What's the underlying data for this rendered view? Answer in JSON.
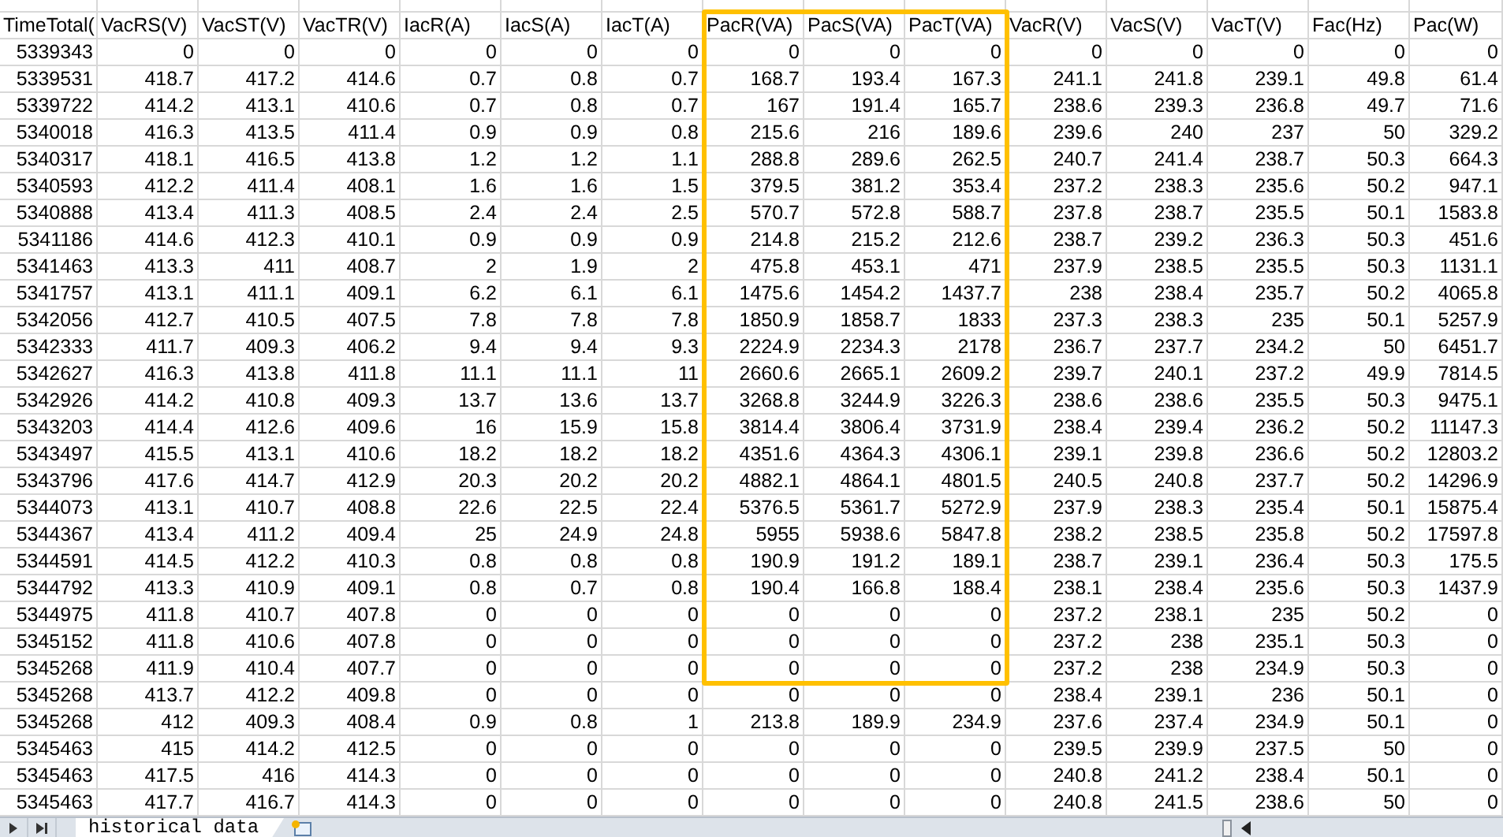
{
  "sheet": {
    "columns": [
      "TimeTotal(",
      "VacRS(V)",
      "VacST(V)",
      "VacTR(V)",
      "IacR(A)",
      "IacS(A)",
      "IacT(A)",
      "PacR(VA)",
      "PacS(VA)",
      "PacT(VA)",
      "VacR(V)",
      "VacS(V)",
      "VacT(V)",
      "Fac(Hz)",
      "Pac(W)"
    ],
    "rows": [
      [
        "5339343",
        "0",
        "0",
        "0",
        "0",
        "0",
        "0",
        "0",
        "0",
        "0",
        "0",
        "0",
        "0",
        "0",
        "0"
      ],
      [
        "5339531",
        "418.7",
        "417.2",
        "414.6",
        "0.7",
        "0.8",
        "0.7",
        "168.7",
        "193.4",
        "167.3",
        "241.1",
        "241.8",
        "239.1",
        "49.8",
        "61.4"
      ],
      [
        "5339722",
        "414.2",
        "413.1",
        "410.6",
        "0.7",
        "0.8",
        "0.7",
        "167",
        "191.4",
        "165.7",
        "238.6",
        "239.3",
        "236.8",
        "49.7",
        "71.6"
      ],
      [
        "5340018",
        "416.3",
        "413.5",
        "411.4",
        "0.9",
        "0.9",
        "0.8",
        "215.6",
        "216",
        "189.6",
        "239.6",
        "240",
        "237",
        "50",
        "329.2"
      ],
      [
        "5340317",
        "418.1",
        "416.5",
        "413.8",
        "1.2",
        "1.2",
        "1.1",
        "288.8",
        "289.6",
        "262.5",
        "240.7",
        "241.4",
        "238.7",
        "50.3",
        "664.3"
      ],
      [
        "5340593",
        "412.2",
        "411.4",
        "408.1",
        "1.6",
        "1.6",
        "1.5",
        "379.5",
        "381.2",
        "353.4",
        "237.2",
        "238.3",
        "235.6",
        "50.2",
        "947.1"
      ],
      [
        "5340888",
        "413.4",
        "411.3",
        "408.5",
        "2.4",
        "2.4",
        "2.5",
        "570.7",
        "572.8",
        "588.7",
        "237.8",
        "238.7",
        "235.5",
        "50.1",
        "1583.8"
      ],
      [
        "5341186",
        "414.6",
        "412.3",
        "410.1",
        "0.9",
        "0.9",
        "0.9",
        "214.8",
        "215.2",
        "212.6",
        "238.7",
        "239.2",
        "236.3",
        "50.3",
        "451.6"
      ],
      [
        "5341463",
        "413.3",
        "411",
        "408.7",
        "2",
        "1.9",
        "2",
        "475.8",
        "453.1",
        "471",
        "237.9",
        "238.5",
        "235.5",
        "50.3",
        "1131.1"
      ],
      [
        "5341757",
        "413.1",
        "411.1",
        "409.1",
        "6.2",
        "6.1",
        "6.1",
        "1475.6",
        "1454.2",
        "1437.7",
        "238",
        "238.4",
        "235.7",
        "50.2",
        "4065.8"
      ],
      [
        "5342056",
        "412.7",
        "410.5",
        "407.5",
        "7.8",
        "7.8",
        "7.8",
        "1850.9",
        "1858.7",
        "1833",
        "237.3",
        "238.3",
        "235",
        "50.1",
        "5257.9"
      ],
      [
        "5342333",
        "411.7",
        "409.3",
        "406.2",
        "9.4",
        "9.4",
        "9.3",
        "2224.9",
        "2234.3",
        "2178",
        "236.7",
        "237.7",
        "234.2",
        "50",
        "6451.7"
      ],
      [
        "5342627",
        "416.3",
        "413.8",
        "411.8",
        "11.1",
        "11.1",
        "11",
        "2660.6",
        "2665.1",
        "2609.2",
        "239.7",
        "240.1",
        "237.2",
        "49.9",
        "7814.5"
      ],
      [
        "5342926",
        "414.2",
        "410.8",
        "409.3",
        "13.7",
        "13.6",
        "13.7",
        "3268.8",
        "3244.9",
        "3226.3",
        "238.6",
        "238.6",
        "235.5",
        "50.3",
        "9475.1"
      ],
      [
        "5343203",
        "414.4",
        "412.6",
        "409.6",
        "16",
        "15.9",
        "15.8",
        "3814.4",
        "3806.4",
        "3731.9",
        "238.4",
        "239.4",
        "236.2",
        "50.2",
        "11147.3"
      ],
      [
        "5343497",
        "415.5",
        "413.1",
        "410.6",
        "18.2",
        "18.2",
        "18.2",
        "4351.6",
        "4364.3",
        "4306.1",
        "239.1",
        "239.8",
        "236.6",
        "50.2",
        "12803.2"
      ],
      [
        "5343796",
        "417.6",
        "414.7",
        "412.9",
        "20.3",
        "20.2",
        "20.2",
        "4882.1",
        "4864.1",
        "4801.5",
        "240.5",
        "240.8",
        "237.7",
        "50.2",
        "14296.9"
      ],
      [
        "5344073",
        "413.1",
        "410.7",
        "408.8",
        "22.6",
        "22.5",
        "22.4",
        "5376.5",
        "5361.7",
        "5272.9",
        "237.9",
        "238.3",
        "235.4",
        "50.1",
        "15875.4"
      ],
      [
        "5344367",
        "413.4",
        "411.2",
        "409.4",
        "25",
        "24.9",
        "24.8",
        "5955",
        "5938.6",
        "5847.8",
        "238.2",
        "238.5",
        "235.8",
        "50.2",
        "17597.8"
      ],
      [
        "5344591",
        "414.5",
        "412.2",
        "410.3",
        "0.8",
        "0.8",
        "0.8",
        "190.9",
        "191.2",
        "189.1",
        "238.7",
        "239.1",
        "236.4",
        "50.3",
        "175.5"
      ],
      [
        "5344792",
        "413.3",
        "410.9",
        "409.1",
        "0.8",
        "0.7",
        "0.8",
        "190.4",
        "166.8",
        "188.4",
        "238.1",
        "238.4",
        "235.6",
        "50.3",
        "1437.9"
      ],
      [
        "5344975",
        "411.8",
        "410.7",
        "407.8",
        "0",
        "0",
        "0",
        "0",
        "0",
        "0",
        "237.2",
        "238.1",
        "235",
        "50.2",
        "0"
      ],
      [
        "5345152",
        "411.8",
        "410.6",
        "407.8",
        "0",
        "0",
        "0",
        "0",
        "0",
        "0",
        "237.2",
        "238",
        "235.1",
        "50.3",
        "0"
      ],
      [
        "5345268",
        "411.9",
        "410.4",
        "407.7",
        "0",
        "0",
        "0",
        "0",
        "0",
        "0",
        "237.2",
        "238",
        "234.9",
        "50.3",
        "0"
      ],
      [
        "5345268",
        "413.7",
        "412.2",
        "409.8",
        "0",
        "0",
        "0",
        "0",
        "0",
        "0",
        "238.4",
        "239.1",
        "236",
        "50.1",
        "0"
      ],
      [
        "5345268",
        "412",
        "409.3",
        "408.4",
        "0.9",
        "0.8",
        "1",
        "213.8",
        "189.9",
        "234.9",
        "237.6",
        "237.4",
        "234.9",
        "50.1",
        "0"
      ],
      [
        "5345463",
        "415",
        "414.2",
        "412.5",
        "0",
        "0",
        "0",
        "0",
        "0",
        "0",
        "239.5",
        "239.9",
        "237.5",
        "50",
        "0"
      ],
      [
        "5345463",
        "417.5",
        "416",
        "414.3",
        "0",
        "0",
        "0",
        "0",
        "0",
        "0",
        "240.8",
        "241.2",
        "238.4",
        "50.1",
        "0"
      ],
      [
        "5345463",
        "417.7",
        "416.7",
        "414.3",
        "0",
        "0",
        "0",
        "0",
        "0",
        "0",
        "240.8",
        "241.5",
        "238.6",
        "50",
        "0"
      ]
    ]
  },
  "sheet_tabs": [
    {
      "label": "historical data",
      "selected": true
    }
  ]
}
